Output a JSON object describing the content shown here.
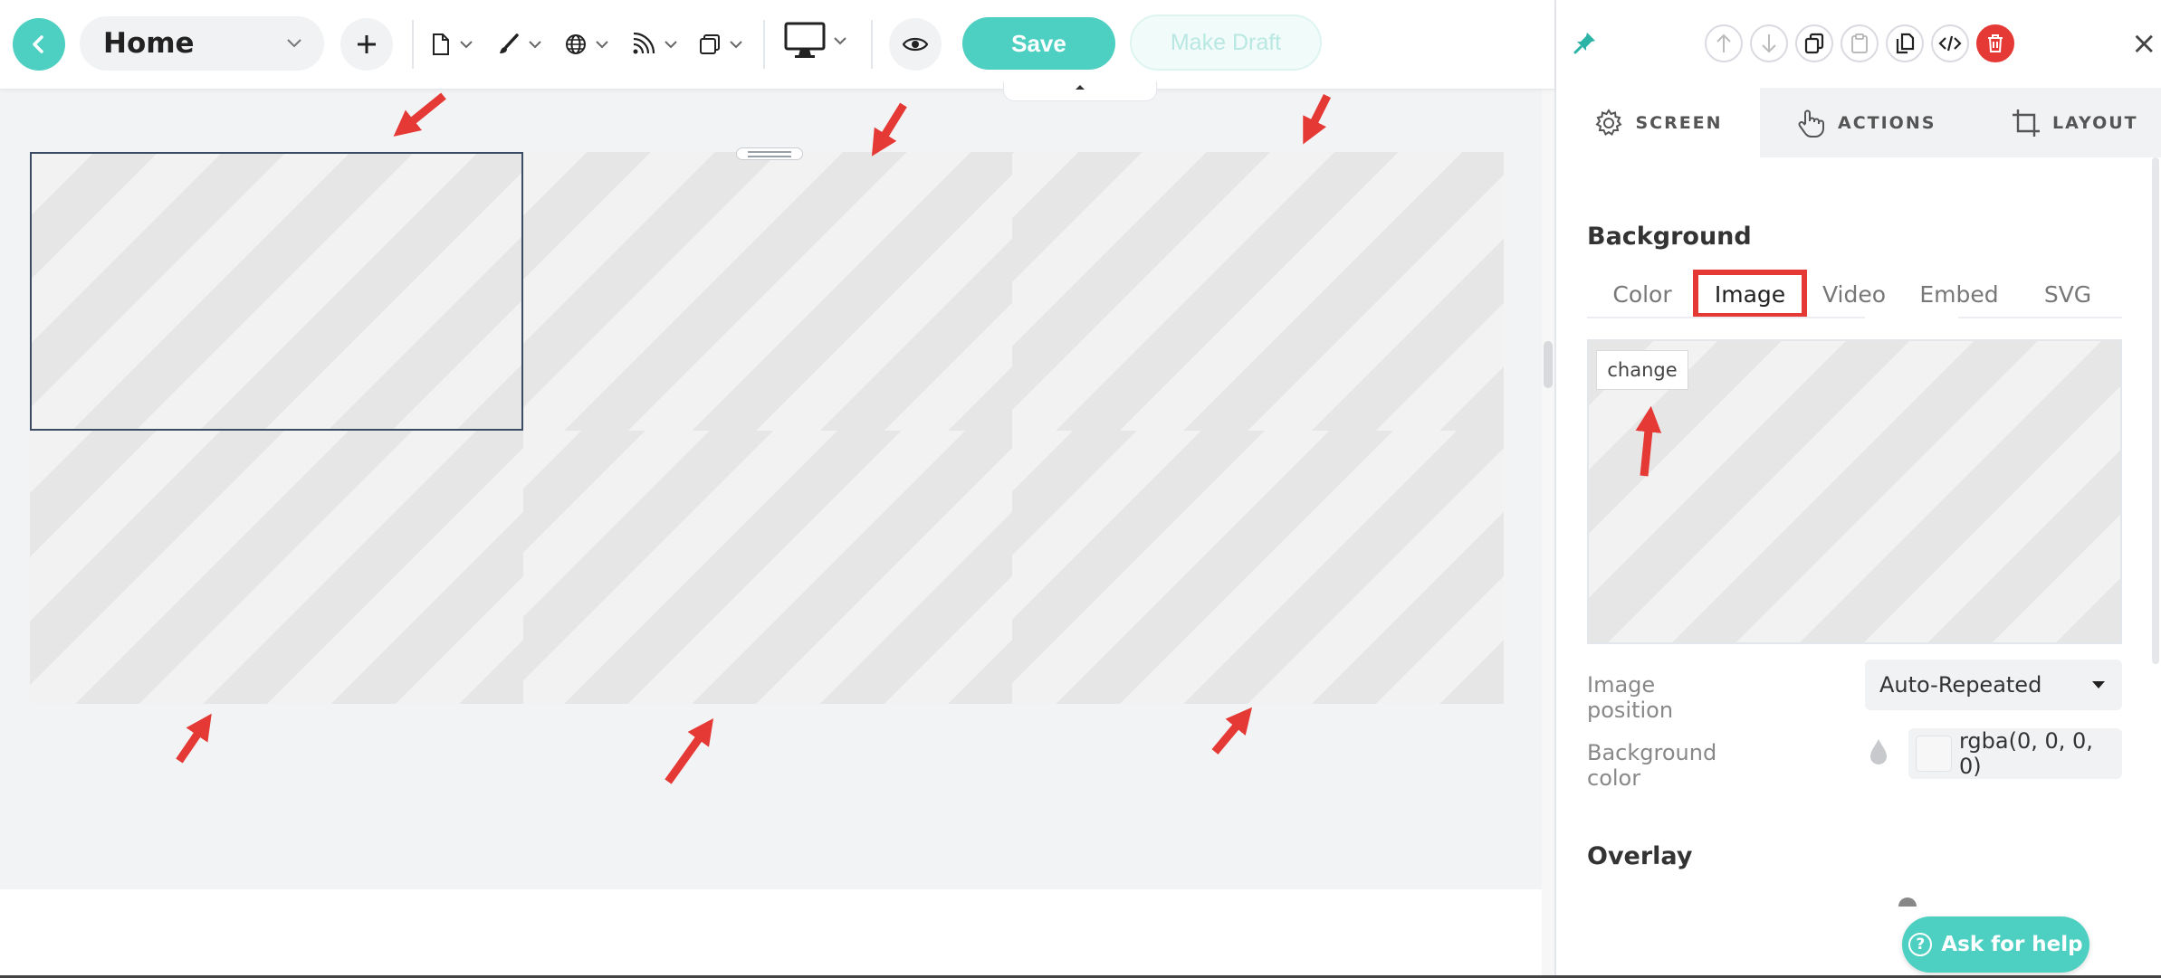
{
  "toolbar": {
    "page_name": "Home",
    "save_label": "Save",
    "draft_label": "Make Draft"
  },
  "icons": {
    "back": "chevron-left-icon",
    "add": "plus-icon",
    "page": "file-icon",
    "style": "brush-icon",
    "web": "globe-icon",
    "feed": "rss-icon",
    "layers": "copy-icon",
    "device": "monitor-icon",
    "preview": "eye-icon"
  },
  "panel": {
    "tabs": [
      {
        "label": "SCREEN",
        "icon": "gear-icon"
      },
      {
        "label": "ACTIONS",
        "icon": "hand-pointer-icon"
      },
      {
        "label": "LAYOUT",
        "icon": "crop-icon"
      }
    ],
    "background_heading": "Background",
    "bg_tabs": [
      "Color",
      "Image",
      "Video",
      "Embed",
      "SVG"
    ],
    "selected_bg_tab": "Image",
    "change_label": "change",
    "image_position_label": "Image position",
    "image_position_value": "Auto-Repeated",
    "background_color_label": "Background color",
    "background_color_value": "rgba(0, 0, 0, 0)",
    "overlay_heading": "Overlay",
    "help_label": "Ask for help",
    "close_glyph": "×"
  },
  "colors": {
    "accent": "#4dd0c2",
    "annotation": "#e53935",
    "delete": "#e53935"
  }
}
